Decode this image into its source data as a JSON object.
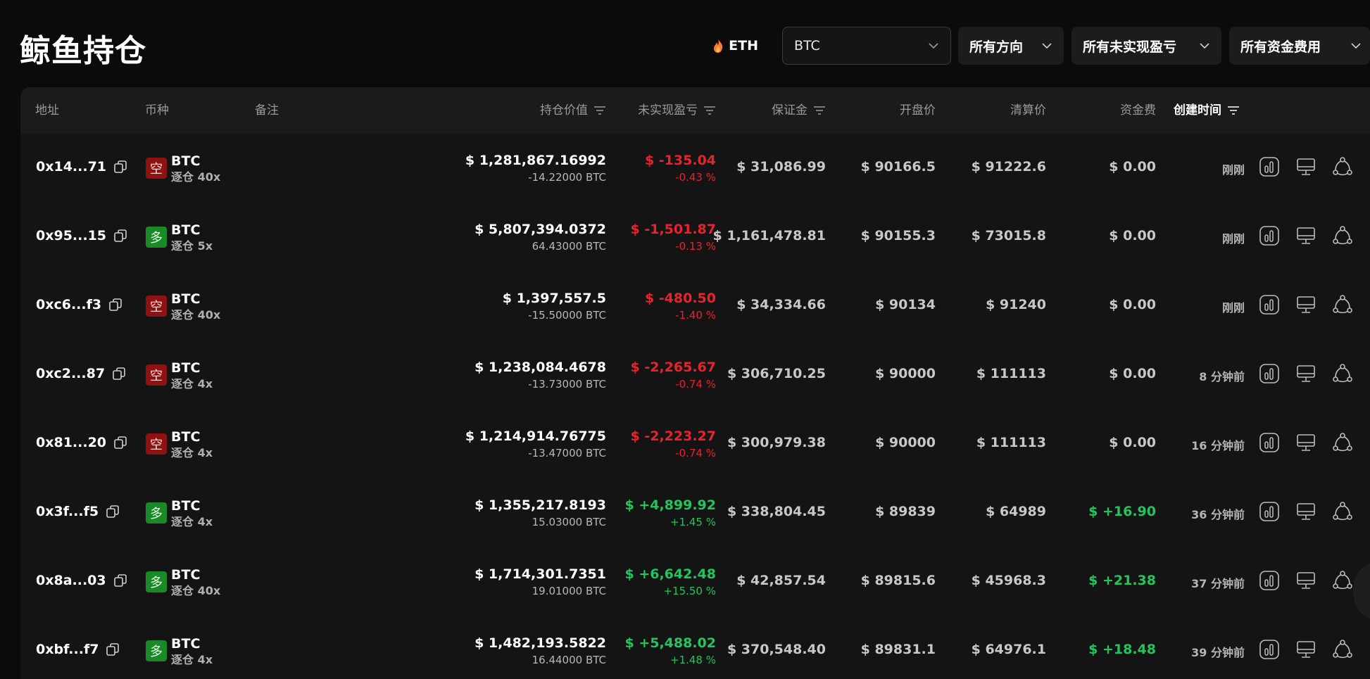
{
  "page": {
    "title": "鲸鱼持仓"
  },
  "filters": {
    "hot_label": "ETH",
    "symbol_value": "BTC",
    "direction_label": "所有方向",
    "pnl_label": "所有未实现盈亏",
    "fee_label": "所有资金费用"
  },
  "colors": {
    "loss": "#e8232e",
    "profit": "#22c55e",
    "short_badge": "#8e1212",
    "long_badge": "#1a8a28",
    "background": "#0b0b0b"
  },
  "table": {
    "headers": {
      "address": "地址",
      "coin": "币种",
      "note": "备注",
      "position_value": "持仓价值",
      "unrealized_pnl": "未实现盈亏",
      "margin": "保证金",
      "open_price": "开盘价",
      "liquidation_price": "清算价",
      "funding_fee": "资金费",
      "created_time": "创建时间"
    },
    "rows": [
      {
        "address": "0x14...71",
        "side": "空",
        "side_type": "short",
        "coin": "BTC",
        "leverage": "逐仓 40x",
        "value": "$ 1,281,867.16992",
        "size": "-14.22000 BTC",
        "pnl": "$ -135.04",
        "pnl_pct": "-0.43 %",
        "pnl_sign": "neg",
        "margin": "$ 31,086.99",
        "open": "$ 90166.5",
        "liq": "$ 91222.6",
        "fee": "$ 0.00",
        "fee_sign": "zero",
        "time": "刚刚"
      },
      {
        "address": "0x95...15",
        "side": "多",
        "side_type": "long",
        "coin": "BTC",
        "leverage": "逐仓 5x",
        "value": "$ 5,807,394.0372",
        "size": "64.43000 BTC",
        "pnl": "$ -1,501.87",
        "pnl_pct": "-0.13 %",
        "pnl_sign": "neg",
        "margin": "$ 1,161,478.81",
        "open": "$ 90155.3",
        "liq": "$ 73015.8",
        "fee": "$ 0.00",
        "fee_sign": "zero",
        "time": "刚刚"
      },
      {
        "address": "0xc6...f3",
        "side": "空",
        "side_type": "short",
        "coin": "BTC",
        "leverage": "逐仓 40x",
        "value": "$ 1,397,557.5",
        "size": "-15.50000 BTC",
        "pnl": "$ -480.50",
        "pnl_pct": "-1.40 %",
        "pnl_sign": "neg",
        "margin": "$ 34,334.66",
        "open": "$ 90134",
        "liq": "$ 91240",
        "fee": "$ 0.00",
        "fee_sign": "zero",
        "time": "刚刚"
      },
      {
        "address": "0xc2...87",
        "side": "空",
        "side_type": "short",
        "coin": "BTC",
        "leverage": "逐仓 4x",
        "value": "$ 1,238,084.4678",
        "size": "-13.73000 BTC",
        "pnl": "$ -2,265.67",
        "pnl_pct": "-0.74 %",
        "pnl_sign": "neg",
        "margin": "$ 306,710.25",
        "open": "$ 90000",
        "liq": "$ 111113",
        "fee": "$ 0.00",
        "fee_sign": "zero",
        "time": "8 分钟前"
      },
      {
        "address": "0x81...20",
        "side": "空",
        "side_type": "short",
        "coin": "BTC",
        "leverage": "逐仓 4x",
        "value": "$ 1,214,914.76775",
        "size": "-13.47000 BTC",
        "pnl": "$ -2,223.27",
        "pnl_pct": "-0.74 %",
        "pnl_sign": "neg",
        "margin": "$ 300,979.38",
        "open": "$ 90000",
        "liq": "$ 111113",
        "fee": "$ 0.00",
        "fee_sign": "zero",
        "time": "16 分钟前"
      },
      {
        "address": "0x3f...f5",
        "side": "多",
        "side_type": "long",
        "coin": "BTC",
        "leverage": "逐仓 4x",
        "value": "$ 1,355,217.8193",
        "size": "15.03000 BTC",
        "pnl": "$ +4,899.92",
        "pnl_pct": "+1.45 %",
        "pnl_sign": "pos",
        "margin": "$ 338,804.45",
        "open": "$ 89839",
        "liq": "$ 64989",
        "fee": "$ +16.90",
        "fee_sign": "pos",
        "time": "36 分钟前"
      },
      {
        "address": "0x8a...03",
        "side": "多",
        "side_type": "long",
        "coin": "BTC",
        "leverage": "逐仓 40x",
        "value": "$ 1,714,301.7351",
        "size": "19.01000 BTC",
        "pnl": "$ +6,642.48",
        "pnl_pct": "+15.50 %",
        "pnl_sign": "pos",
        "margin": "$ 42,857.54",
        "open": "$ 89815.6",
        "liq": "$ 45968.3",
        "fee": "$ +21.38",
        "fee_sign": "pos",
        "time": "37 分钟前"
      },
      {
        "address": "0xbf...f7",
        "side": "多",
        "side_type": "long",
        "coin": "BTC",
        "leverage": "逐仓 4x",
        "value": "$ 1,482,193.5822",
        "size": "16.44000 BTC",
        "pnl": "$ +5,488.02",
        "pnl_pct": "+1.48 %",
        "pnl_sign": "pos",
        "margin": "$ 370,548.40",
        "open": "$ 89831.1",
        "liq": "$ 64976.1",
        "fee": "$ +18.48",
        "fee_sign": "pos",
        "time": "39 分钟前"
      }
    ]
  }
}
